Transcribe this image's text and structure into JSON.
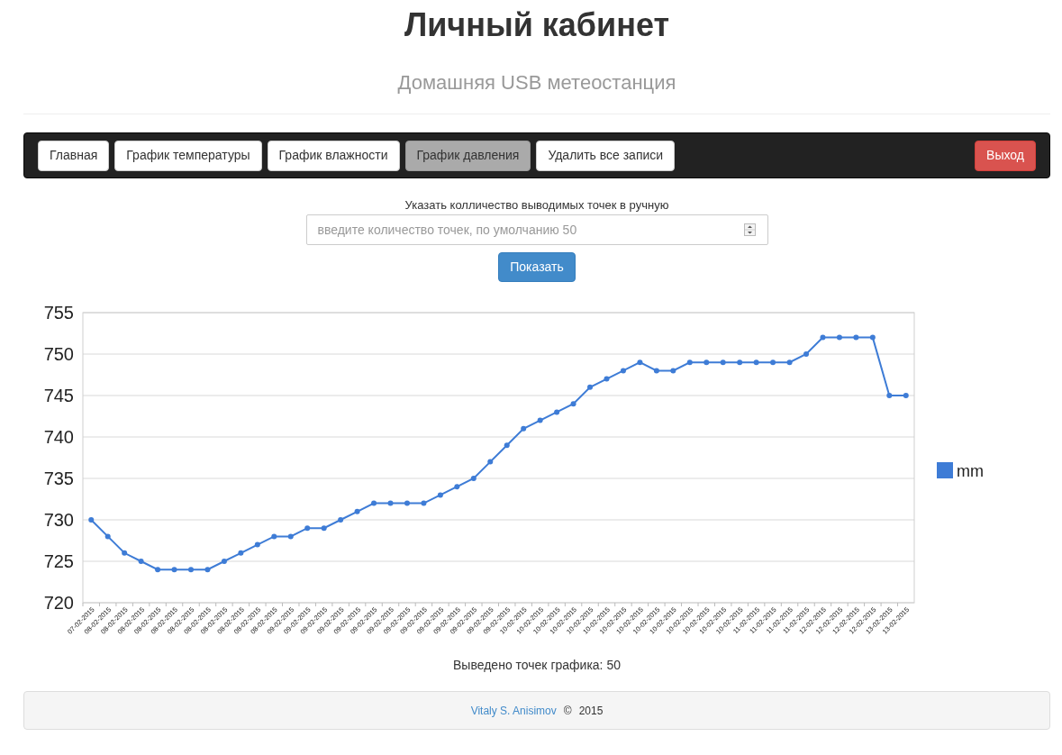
{
  "header": {
    "title": "Личный кабинет",
    "subtitle": "Домашняя USB метеостанция"
  },
  "navbar": {
    "items": [
      {
        "label": "Главная",
        "selected": false
      },
      {
        "label": "График температуры",
        "selected": false
      },
      {
        "label": "График влажности",
        "selected": false
      },
      {
        "label": "График давления",
        "selected": true
      },
      {
        "label": "Удалить все записи",
        "selected": false
      }
    ],
    "logout": "Выход"
  },
  "points_form": {
    "label": "Указать колличество выводимых точек в ручную",
    "input": {
      "placeholder": "введите количество точек, по умолчанию 50"
    },
    "submit": "Показать"
  },
  "chart": {
    "chart_data": {
      "type": "line",
      "grid": true,
      "categories": [
        "07-02-2015",
        "08-02-2015",
        "08-02-2015",
        "08-02-2015",
        "08-02-2015",
        "08-02-2015",
        "08-02-2015",
        "08-02-2015",
        "08-02-2015",
        "08-02-2015",
        "08-02-2015",
        "08-02-2015",
        "09-02-2015",
        "09-02-2015",
        "09-02-2015",
        "09-02-2015",
        "09-02-2015",
        "09-02-2015",
        "09-02-2015",
        "09-02-2015",
        "09-02-2015",
        "09-02-2015",
        "09-02-2015",
        "09-02-2015",
        "09-02-2015",
        "09-02-2015",
        "10-02-2015",
        "10-02-2015",
        "10-02-2015",
        "10-02-2015",
        "10-02-2015",
        "10-02-2015",
        "10-02-2015",
        "10-02-2015",
        "10-02-2015",
        "10-02-2015",
        "10-02-2015",
        "10-02-2015",
        "10-02-2015",
        "10-02-2015",
        "11-02-2015",
        "11-02-2015",
        "11-02-2015",
        "11-02-2015",
        "12-02-2015",
        "12-02-2015",
        "12-02-2015",
        "12-02-2015",
        "13-02-2015",
        "13-02-2015"
      ],
      "series": [
        {
          "name": "mm",
          "color": "#3e7cd6",
          "marker": "circle",
          "values": [
            730,
            728,
            726,
            725,
            724,
            724,
            724,
            724,
            725,
            726,
            727,
            728,
            728,
            729,
            729,
            730,
            731,
            732,
            732,
            732,
            732,
            733,
            734,
            735,
            737,
            739,
            741,
            742,
            743,
            744,
            746,
            747,
            748,
            749,
            748,
            748,
            749,
            749,
            749,
            749,
            749,
            749,
            749,
            750,
            752,
            752,
            752,
            752,
            745,
            745
          ]
        }
      ],
      "ylim": [
        720,
        755
      ],
      "yticks": [
        720,
        725,
        730,
        735,
        740,
        745,
        750,
        755
      ]
    }
  },
  "points_count": "Выведено точек графика: 50",
  "footer": {
    "author": "Vitaly S. Anisimov",
    "copyright": "©",
    "year": "2015"
  }
}
